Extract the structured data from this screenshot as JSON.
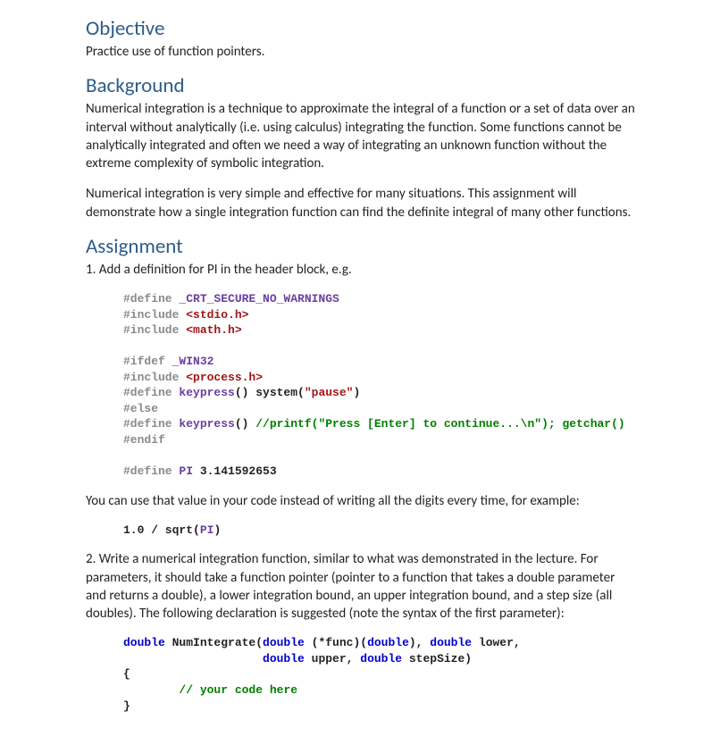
{
  "objective": {
    "heading": "Objective",
    "text": "Practice use of function pointers."
  },
  "background": {
    "heading": "Background",
    "p1": "Numerical integration is a technique to approximate the integral of a function or a set of data over an interval without analytically (i.e. using calculus) integrating the function. Some functions cannot be analytically integrated and often we need a way of integrating an unknown function without the extreme complexity of symbolic integration.",
    "p2": "Numerical integration is very simple and effective for many situations. This assignment will demonstrate how a single integration function can find the definite integral of many other functions."
  },
  "assignment": {
    "heading": "Assignment",
    "step1": "1. Add a definition for PI in the header block, e.g.",
    "code1": {
      "l1a": "#define",
      "l1b": " _CRT_SECURE_NO_WARNINGS",
      "l2a": "#include",
      "l2b": " <stdio.h>",
      "l3a": "#include",
      "l3b": " <math.h>",
      "blank": "",
      "l4a": "#ifdef",
      "l4b": " _WIN32",
      "l5a": "#include",
      "l5b": " <process.h>",
      "l6a": "#define",
      "l6b": " keypress",
      "l6c": "() system(",
      "l6d": "\"pause\"",
      "l6e": ")",
      "l7": "#else",
      "l8a": "#define",
      "l8b": " keypress",
      "l8c": "() ",
      "l8d": "//printf(\"Press [Enter] to continue...\\n\"); getchar()",
      "l9": "#endif",
      "l10a": "#define",
      "l10b": " PI ",
      "l10c": "3.141592653"
    },
    "transition": "You can use that value in your code instead of writing all the digits every time, for example:",
    "code2": {
      "l1a": "1.0",
      "l1b": " / sqrt(",
      "l1c": "PI",
      "l1d": ")"
    },
    "step2": "2. Write a numerical integration function, similar to what was demonstrated in the lecture. For parameters, it should take a function pointer (pointer to a function that takes a double parameter and returns a double), a lower integration bound, an upper integration bound, and a step size (all doubles). The following declaration is suggested (note the syntax of the first parameter):",
    "code3": {
      "l1a": "double",
      "l1b": " NumIntegrate(",
      "l1c": "double",
      "l1d": " (*func)(",
      "l1e": "double",
      "l1f": "), ",
      "l1g": "double",
      "l1h": " lower,",
      "l2a": "                    ",
      "l2b": "double",
      "l2c": " upper, ",
      "l2d": "double",
      "l2e": " stepSize)",
      "l3": "{",
      "l4a": "        ",
      "l4b": "// your code here",
      "l5": "}"
    }
  }
}
